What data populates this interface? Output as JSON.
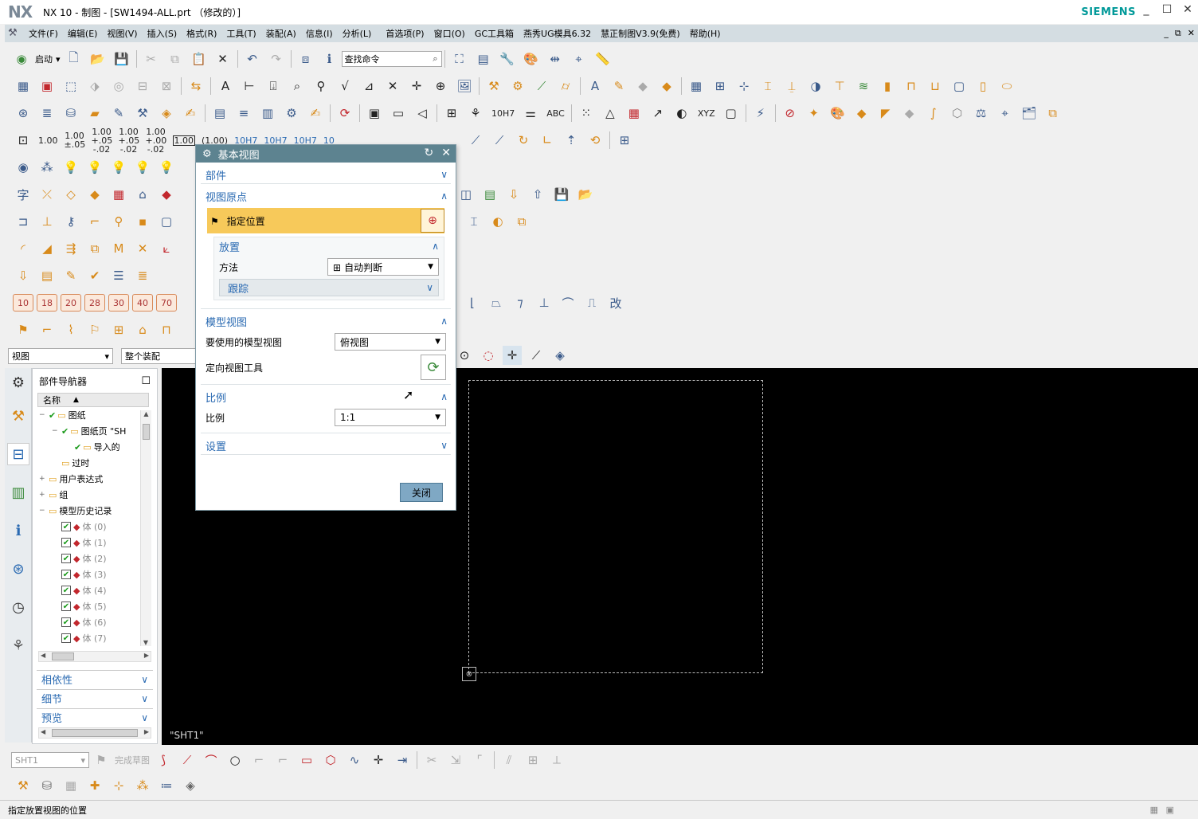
{
  "window": {
    "logo": "NX",
    "title": "NX 10 - 制图 - [SW1494-ALL.prt （修改的）]",
    "brand": "SIEMENS",
    "minimize": "_",
    "maximize": "☐",
    "close": "✕"
  },
  "menu": {
    "items": [
      "文件(F)",
      "编辑(E)",
      "视图(V)",
      "插入(S)",
      "格式(R)",
      "工具(T)",
      "装配(A)",
      "信息(I)",
      "分析(L)",
      "首选项(P)",
      "窗口(O)",
      "GC工具箱",
      "燕秀UG模具6.32",
      "慧正制图V3.9(免费)",
      "帮助(H)"
    ],
    "mdi_controls": [
      "_",
      "⧉",
      "✕"
    ]
  },
  "toolbar1": {
    "start_label": "启动",
    "find_placeholder": "查找命令"
  },
  "toolbar4": {
    "nums": [
      "1.00",
      "1.00 ±.05",
      "1.00 +.05 -.02",
      "1.00 +.05 -.02",
      "1.00 +.00 -.02",
      "1.00",
      "(1.00)",
      "10H7",
      "10H7",
      "10H7",
      "10"
    ]
  },
  "numtoolbar": {
    "values": [
      "10",
      "18",
      "20",
      "28",
      "30",
      "40",
      "70"
    ]
  },
  "selection_bar": {
    "filter": "视图",
    "scope": "整个装配"
  },
  "navigator": {
    "title": "部件导航器",
    "column_name": "名称",
    "nodes": [
      {
        "indent": 0,
        "exp": "−",
        "check": true,
        "label": "图纸"
      },
      {
        "indent": 1,
        "exp": "−",
        "check": true,
        "label": "图纸页 \"SH"
      },
      {
        "indent": 2,
        "exp": "",
        "check": true,
        "label": "导入的"
      },
      {
        "indent": 1,
        "exp": "",
        "check": false,
        "label": "过时"
      },
      {
        "indent": 0,
        "exp": "+",
        "check": false,
        "label": "用户表达式"
      },
      {
        "indent": 0,
        "exp": "+",
        "check": false,
        "label": "组"
      },
      {
        "indent": 0,
        "exp": "−",
        "check": false,
        "label": "模型历史记录"
      },
      {
        "indent": 1,
        "exp": "",
        "box": true,
        "label": "体 (0)"
      },
      {
        "indent": 1,
        "exp": "",
        "box": true,
        "label": "体 (1)"
      },
      {
        "indent": 1,
        "exp": "",
        "box": true,
        "label": "体 (2)"
      },
      {
        "indent": 1,
        "exp": "",
        "box": true,
        "label": "体 (3)"
      },
      {
        "indent": 1,
        "exp": "",
        "box": true,
        "label": "体 (4)"
      },
      {
        "indent": 1,
        "exp": "",
        "box": true,
        "label": "体 (5)"
      },
      {
        "indent": 1,
        "exp": "",
        "box": true,
        "label": "体 (6)"
      },
      {
        "indent": 1,
        "exp": "",
        "box": true,
        "label": "体 (7)"
      }
    ],
    "sections": [
      "相依性",
      "细节",
      "预览"
    ]
  },
  "graphics": {
    "sheet_label": "\"SHT1\""
  },
  "bottom_toolbar": {
    "sheet_combo": "SHT1",
    "finish_sketch": "完成草图"
  },
  "status": {
    "text": "指定放置视图的位置"
  },
  "dialog": {
    "title": "基本视图",
    "groups": {
      "part": "部件",
      "view_origin": "视图原点",
      "specify_location": "指定位置",
      "placement": "放置",
      "method_label": "方法",
      "method_value": "自动判断",
      "tracking": "跟踪",
      "model_view": "模型视图",
      "model_view_label": "要使用的模型视图",
      "model_view_value": "俯视图",
      "orient_tool_label": "定向视图工具",
      "scale": "比例",
      "scale_label": "比例",
      "scale_value": "1:1",
      "settings": "设置"
    },
    "close_button": "关闭"
  }
}
